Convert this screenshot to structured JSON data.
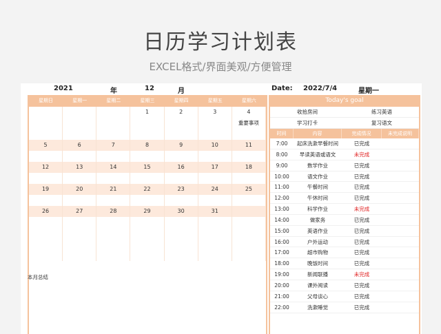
{
  "title": "日历学习计划表",
  "subtitle": "EXCEL格式/界面美观/方便管理",
  "header": {
    "year": "2021",
    "year_label": "年",
    "month": "12",
    "month_label": "月",
    "date_label": "Date:",
    "date": "2022/7/4",
    "weekday": "星期一"
  },
  "weekdays": [
    "星期日",
    "星期一",
    "星期二",
    "星期三",
    "星期四",
    "星期五",
    "星期六"
  ],
  "weeks": [
    {
      "days": [
        "",
        "",
        "",
        "1",
        "2",
        "3",
        "4"
      ],
      "notes": [
        "",
        "",
        "",
        "",
        "",
        "",
        "重要事项"
      ]
    },
    {
      "days": [
        "5",
        "6",
        "7",
        "8",
        "9",
        "10",
        "11"
      ]
    },
    {
      "days": [
        "12",
        "13",
        "14",
        "15",
        "16",
        "17",
        "18"
      ]
    },
    {
      "days": [
        "19",
        "20",
        "21",
        "22",
        "23",
        "24",
        "25"
      ]
    },
    {
      "days": [
        "26",
        "27",
        "28",
        "29",
        "30",
        "31",
        ""
      ]
    }
  ],
  "summary_label": "本月总结",
  "goal_title": "Today's goal",
  "goals": [
    [
      "收拾房间",
      "练习英语"
    ],
    [
      "学习打卡",
      "复习语文"
    ]
  ],
  "schedule_headers": [
    "时间",
    "内容",
    "完成情况",
    "未完成说明"
  ],
  "schedule": [
    {
      "time": "7:00",
      "content": "起床洗漱早餐时间",
      "status": "已完成",
      "done": true
    },
    {
      "time": "8:00",
      "content": "早读英语或语文",
      "status": "未完成",
      "done": false
    },
    {
      "time": "9:00",
      "content": "数学作业",
      "status": "已完成",
      "done": true
    },
    {
      "time": "10:00",
      "content": "语文作业",
      "status": "已完成",
      "done": true
    },
    {
      "time": "11:00",
      "content": "午餐时间",
      "status": "已完成",
      "done": true
    },
    {
      "time": "12:00",
      "content": "午休时间",
      "status": "已完成",
      "done": true
    },
    {
      "time": "13:00",
      "content": "科学作业",
      "status": "未完成",
      "done": false
    },
    {
      "time": "14:00",
      "content": "做家务",
      "status": "已完成",
      "done": true
    },
    {
      "time": "15:00",
      "content": "英语作业",
      "status": "已完成",
      "done": true
    },
    {
      "time": "16:00",
      "content": "户外运动",
      "status": "已完成",
      "done": true
    },
    {
      "time": "17:00",
      "content": "超市购物",
      "status": "已完成",
      "done": true
    },
    {
      "time": "18:00",
      "content": "晚饭时间",
      "status": "已完成",
      "done": true
    },
    {
      "time": "19:00",
      "content": "新闻联播",
      "status": "未完成",
      "done": false
    },
    {
      "time": "20:00",
      "content": "课外阅读",
      "status": "已完成",
      "done": true
    },
    {
      "time": "21:00",
      "content": "父母谈心",
      "status": "已完成",
      "done": true
    },
    {
      "time": "22:00",
      "content": "洗漱睡觉",
      "status": "已完成",
      "done": true
    }
  ]
}
